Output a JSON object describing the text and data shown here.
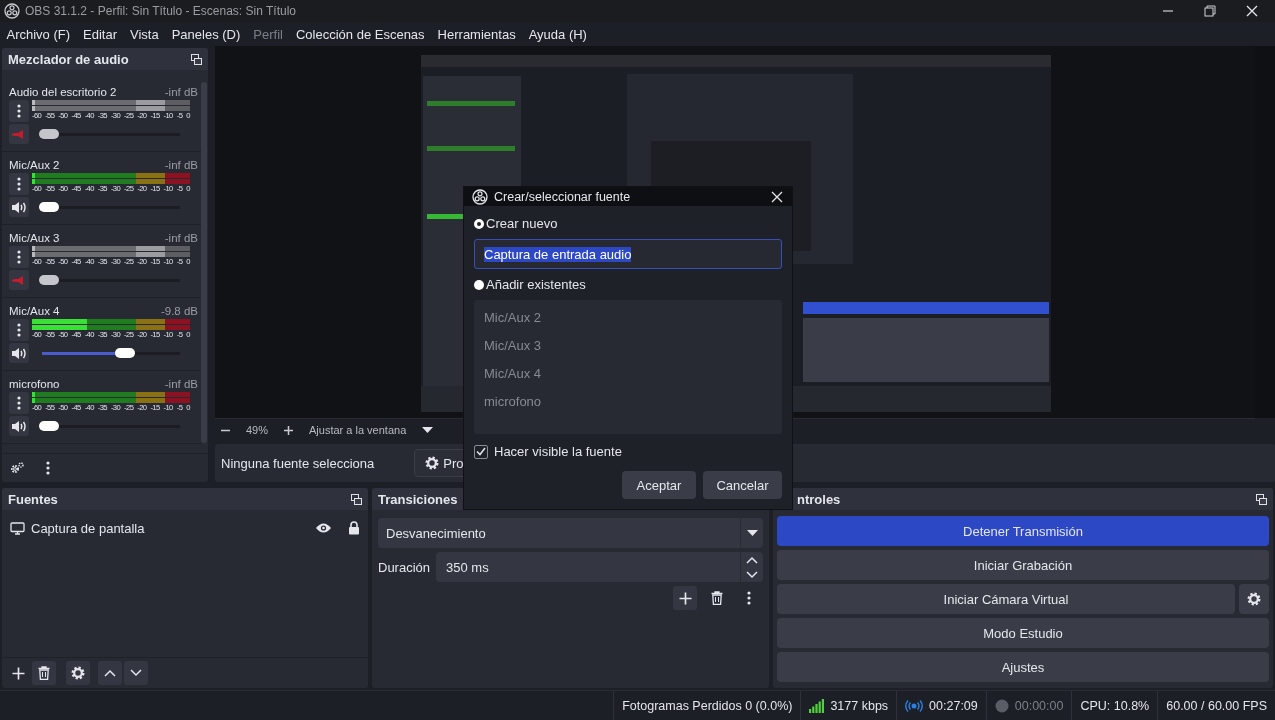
{
  "window": {
    "title": "OBS 31.1.2 - Perfil: Sin Título - Escenas: Sin Título"
  },
  "menu": [
    {
      "label": "Archivo (F)",
      "disabled": false
    },
    {
      "label": "Editar",
      "disabled": false
    },
    {
      "label": "Vista",
      "disabled": false
    },
    {
      "label": "Paneles (D)",
      "disabled": false
    },
    {
      "label": "Perfil",
      "disabled": true
    },
    {
      "label": "Colección de Escenas",
      "disabled": false
    },
    {
      "label": "Herramientas",
      "disabled": false
    },
    {
      "label": "Ayuda (H)",
      "disabled": false
    }
  ],
  "audio_mixer": {
    "title": "Mezclador de audio",
    "channels": [
      {
        "name": "Audio del escritorio 2",
        "reading": "-inf dB",
        "muted": true,
        "meter": {
          "level": 0.02
        },
        "scale": [
          "-60",
          "-55",
          "-50",
          "-45",
          "-40",
          "-35",
          "-30",
          "-25",
          "-20",
          "-15",
          "-10",
          "-5",
          "0"
        ],
        "volume": {
          "level": 0.05
        }
      },
      {
        "name": "Mic/Aux 2",
        "reading": "-inf dB",
        "muted": false,
        "meter": {
          "level": 0.02
        },
        "scale": [
          "-60",
          "-55",
          "-50",
          "-45",
          "-40",
          "-35",
          "-30",
          "-25",
          "-20",
          "-15",
          "-10",
          "-5",
          "0"
        ],
        "volume": {
          "level": 0.05
        }
      },
      {
        "name": "Mic/Aux 3",
        "reading": "-inf dB",
        "muted": true,
        "meter": {
          "level": 0.02
        },
        "scale": [
          "-60",
          "-55",
          "-50",
          "-45",
          "-40",
          "-35",
          "-30",
          "-25",
          "-20",
          "-15",
          "-10",
          "-5",
          "0"
        ],
        "volume": {
          "level": 0.05
        }
      },
      {
        "name": "Mic/Aux 4",
        "reading": "-9.8 dB",
        "muted": false,
        "meter": {
          "level": 0.35
        },
        "scale": [
          "-60",
          "-55",
          "-50",
          "-45",
          "-40",
          "-35",
          "-30",
          "-25",
          "-20",
          "-15",
          "-10",
          "-5",
          "0"
        ],
        "volume": {
          "level": 0.6
        }
      },
      {
        "name": "microfono",
        "reading": "-inf dB",
        "muted": false,
        "meter": {
          "level": 0.02
        },
        "scale": [
          "-60",
          "-55",
          "-50",
          "-45",
          "-40",
          "-35",
          "-30",
          "-25",
          "-20",
          "-15",
          "-10",
          "-5",
          "0"
        ],
        "volume": {
          "level": 0.05
        }
      }
    ]
  },
  "preview": {
    "kind": "picture",
    "zoom": "49%",
    "fit": "Ajustar a la ventana"
  },
  "context_bar": {
    "selection": "Ninguna fuente selecciona",
    "properties_button": "Pro"
  },
  "sources": {
    "title": "Fuentes",
    "items": [
      {
        "name": "Captura de pantalla",
        "visible": true,
        "locked": true
      }
    ]
  },
  "transitions": {
    "title": "Transiciones",
    "transition": "Desvanecimiento",
    "duration_label": "Duración",
    "duration": "350 ms"
  },
  "controls": {
    "title": "ntroles",
    "buttons": [
      {
        "label": "Detener Transmisión",
        "active": true,
        "settings": false
      },
      {
        "label": "Iniciar Grabación",
        "active": false,
        "settings": false
      },
      {
        "label": "Iniciar Cámara Virtual",
        "active": false,
        "settings": true
      },
      {
        "label": "Modo Estudio",
        "active": false,
        "settings": false
      },
      {
        "label": "Ajustes",
        "active": false,
        "settings": false
      }
    ]
  },
  "status_bar": {
    "dropped_frames": "Fotogramas Perdidos 0 (0.0%)",
    "bitrate": "3177 kbps",
    "stream_time": "00:27:09",
    "streaming": true,
    "record_time": "00:00:00",
    "recording": false,
    "cpu": "CPU: 10.8%",
    "fps": "60.00 / 60.00 FPS"
  },
  "dialog": {
    "title": "Crear/seleccionar fuente",
    "options": [
      {
        "label": "Crear nuevo",
        "selected": true
      },
      {
        "label": "Añadir existentes",
        "selected": false
      }
    ],
    "name_value": "Captura de entrada audio",
    "existing": [
      "Mic/Aux 2",
      "Mic/Aux 3",
      "Mic/Aux 4",
      "microfono"
    ],
    "visible_label": "Hacer visible la fuente",
    "visible_checked": true,
    "buttons": [
      "Aceptar",
      "Cancelar"
    ]
  }
}
